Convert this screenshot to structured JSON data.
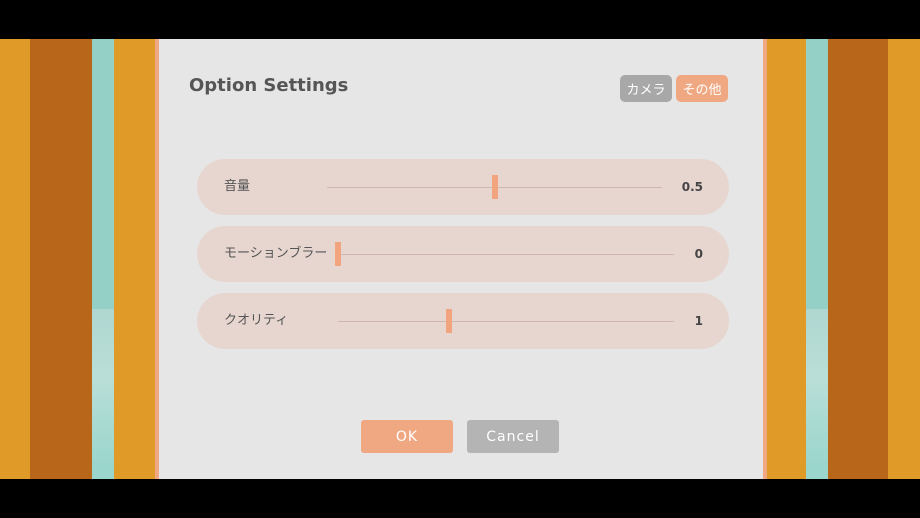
{
  "dialog": {
    "title": "Option Settings",
    "tabs": [
      {
        "label": "カメラ",
        "active": false
      },
      {
        "label": "その他",
        "active": true
      }
    ]
  },
  "settings": [
    {
      "label": "音量",
      "value": "0.5",
      "fraction": 0.5
    },
    {
      "label": "モーションブラー",
      "value": "0",
      "fraction": 0.0
    },
    {
      "label": "クオリティ",
      "value": "1",
      "fraction": 0.33
    }
  ],
  "buttons": {
    "ok": "OK",
    "cancel": "Cancel"
  },
  "colors": {
    "accent": "#f0a882",
    "panel": "#e6e6e6",
    "row": "#e7d6d0",
    "inactive": "#a8a8a8"
  }
}
